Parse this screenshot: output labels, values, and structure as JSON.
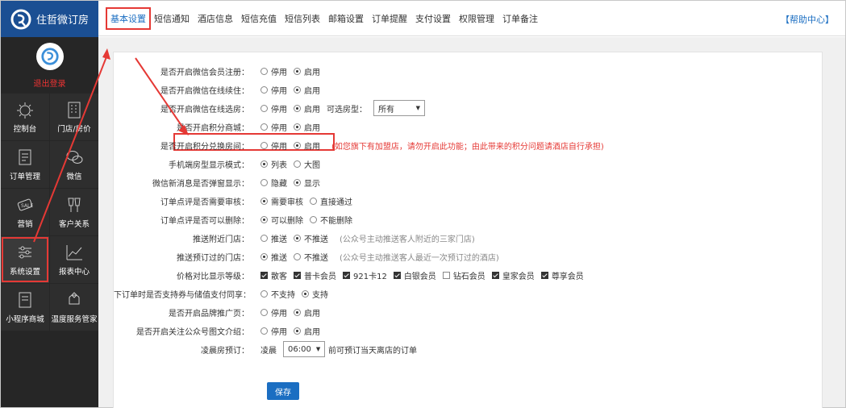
{
  "brand": {
    "name": "住哲微订房"
  },
  "sidebar": {
    "logout": "退出登录",
    "items": [
      {
        "label": "控制台",
        "icon": "dashboard-icon"
      },
      {
        "label": "门店/房价",
        "icon": "building-icon"
      },
      {
        "label": "订单管理",
        "icon": "order-icon"
      },
      {
        "label": "微信",
        "icon": "wechat-icon"
      },
      {
        "label": "营销",
        "icon": "sale-tag-icon"
      },
      {
        "label": "客户关系",
        "icon": "customer-icon"
      },
      {
        "label": "系统设置",
        "icon": "settings-icon"
      },
      {
        "label": "报表中心",
        "icon": "report-icon"
      },
      {
        "label": "小程序商城",
        "icon": "miniapp-icon"
      },
      {
        "label": "温度服务管家",
        "icon": "service-icon"
      }
    ],
    "active": "系统设置"
  },
  "nav": {
    "tabs": [
      "基本设置",
      "短信通知",
      "酒店信息",
      "短信充值",
      "短信列表",
      "邮箱设置",
      "订单提醒",
      "支付设置",
      "权限管理",
      "订单备注"
    ],
    "active": "基本设置",
    "help": "【帮助中心】"
  },
  "settings": [
    {
      "label": "是否开启微信会员注册：",
      "options": [
        {
          "t": "停用",
          "on": false
        },
        {
          "t": "启用",
          "on": true
        }
      ]
    },
    {
      "label": "是否开启微信在线续住：",
      "options": [
        {
          "t": "停用",
          "on": false
        },
        {
          "t": "启用",
          "on": true
        }
      ]
    },
    {
      "label": "是否开启微信在线选房：",
      "options": [
        {
          "t": "停用",
          "on": false
        },
        {
          "t": "启用",
          "on": true
        }
      ],
      "extra_label": "可选房型：",
      "select": "所有"
    },
    {
      "label": "是否开启积分商城：",
      "options": [
        {
          "t": "停用",
          "on": false
        },
        {
          "t": "启用",
          "on": true
        }
      ]
    },
    {
      "label": "是否开启积分兑换房间：",
      "options": [
        {
          "t": "停用",
          "on": false
        },
        {
          "t": "启用",
          "on": true
        }
      ],
      "warn": "(如您旗下有加盟店，请勿开启此功能；由此带来的积分问题请酒店自行承担)"
    },
    {
      "label": "手机端房型显示模式：",
      "options": [
        {
          "t": "列表",
          "on": true
        },
        {
          "t": "大图",
          "on": false
        }
      ]
    },
    {
      "label": "微信新消息是否弹窗显示：",
      "options": [
        {
          "t": "隐藏",
          "on": false
        },
        {
          "t": "显示",
          "on": true
        }
      ]
    },
    {
      "label": "订单点评是否需要审核：",
      "options": [
        {
          "t": "需要审核",
          "on": true
        },
        {
          "t": "直接通过",
          "on": false
        }
      ]
    },
    {
      "label": "订单点评是否可以删除：",
      "options": [
        {
          "t": "可以删除",
          "on": true
        },
        {
          "t": "不能删除",
          "on": false
        }
      ]
    },
    {
      "label": "推送附近门店：",
      "options": [
        {
          "t": "推送",
          "on": false
        },
        {
          "t": "不推送",
          "on": true
        }
      ],
      "note": "(公众号主动推送客人附近的三家门店)"
    },
    {
      "label": "推送预订过的门店：",
      "options": [
        {
          "t": "推送",
          "on": true
        },
        {
          "t": "不推送",
          "on": false
        }
      ],
      "note": "(公众号主动推送客人最近一次预订过的酒店)"
    },
    {
      "label": "价格对比显示等级：",
      "checks": [
        {
          "t": "散客",
          "on": true
        },
        {
          "t": "普卡会员",
          "on": true
        },
        {
          "t": "921卡12",
          "on": true
        },
        {
          "t": "白银会员",
          "on": true
        },
        {
          "t": "钻石会员",
          "on": false
        },
        {
          "t": "皇家会员",
          "on": true
        },
        {
          "t": "尊享会员",
          "on": true
        }
      ]
    },
    {
      "label": "下订单时是否支持券与储值支付同享：",
      "options": [
        {
          "t": "不支持",
          "on": false
        },
        {
          "t": "支持",
          "on": true
        }
      ]
    },
    {
      "label": "是否开启品牌推广页：",
      "options": [
        {
          "t": "停用",
          "on": false
        },
        {
          "t": "启用",
          "on": true
        }
      ]
    },
    {
      "label": "是否开启关注公众号图文介绍：",
      "options": [
        {
          "t": "停用",
          "on": false
        },
        {
          "t": "启用",
          "on": true
        }
      ]
    },
    {
      "label": "凌晨房预订：",
      "prefix": "凌晨",
      "time": "06:00",
      "suffix": "前可预订当天离店的订单"
    }
  ],
  "save_label": "保存",
  "colors": {
    "accent": "#1b6ec2",
    "brand_bar": "#1b4f93",
    "sidebar": "#262626",
    "highlight": "#e53935"
  }
}
